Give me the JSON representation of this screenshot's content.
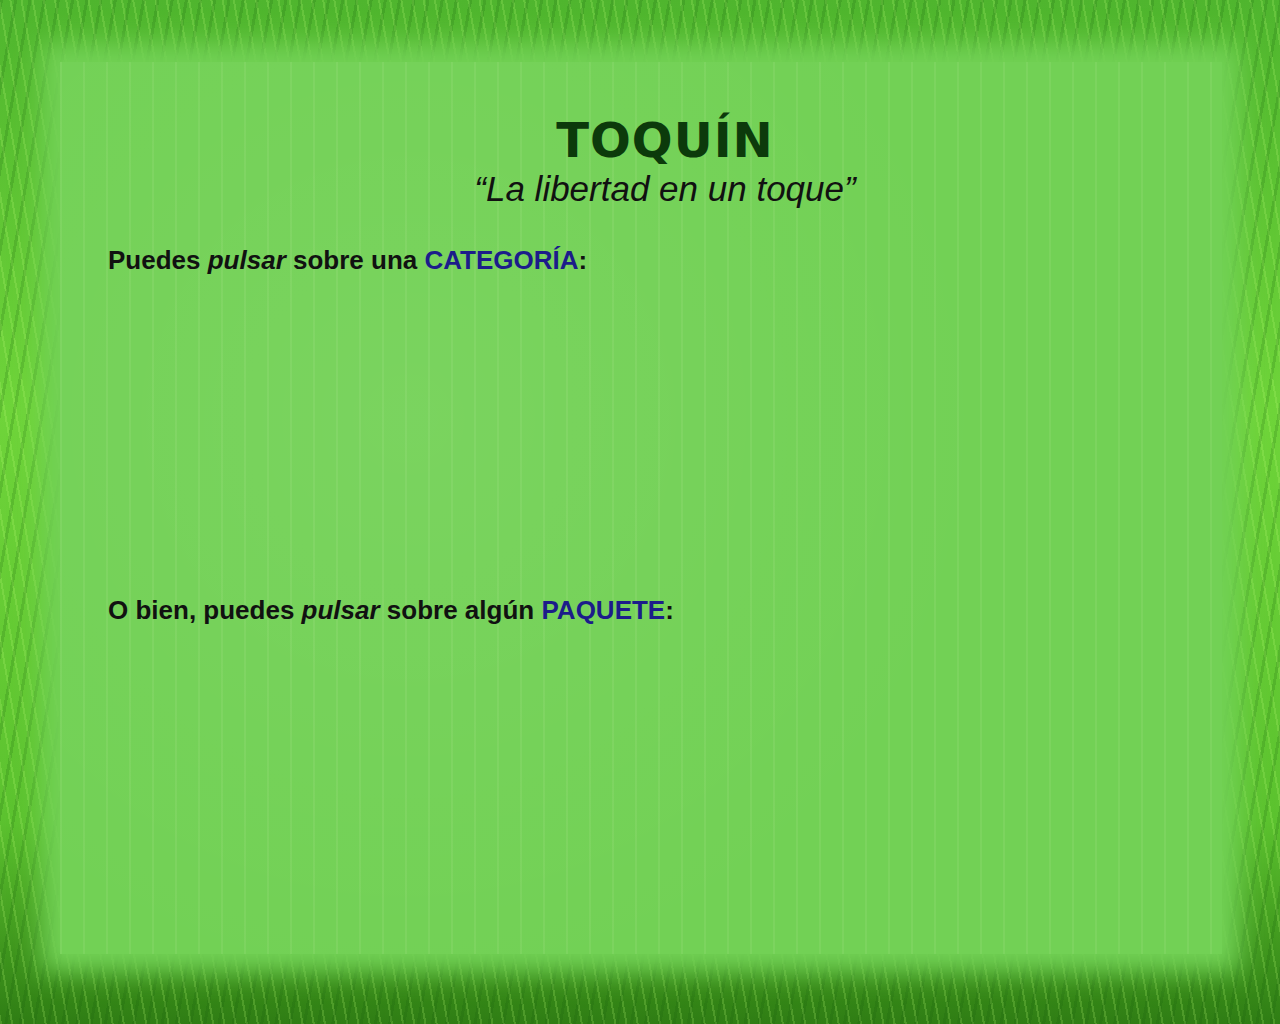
{
  "app": {
    "title": "TOQUÍN",
    "slogan": "“La libertad en un toque”"
  },
  "sections": [
    {
      "name": "categories",
      "prompt": [
        {
          "text": "Puedes ",
          "kind": "plain"
        },
        {
          "text": "pulsar",
          "kind": "emphasis"
        },
        {
          "text": " sobre una ",
          "kind": "plain"
        },
        {
          "text": "CATEGORÍA",
          "kind": "highlight"
        },
        {
          "text": ":",
          "kind": "plain"
        }
      ],
      "items": []
    },
    {
      "name": "packages",
      "prompt": [
        {
          "text": "O bien, puedes ",
          "kind": "plain"
        },
        {
          "text": "pulsar",
          "kind": "emphasis"
        },
        {
          "text": " sobre algún ",
          "kind": "plain"
        },
        {
          "text": "PAQUETE",
          "kind": "highlight"
        },
        {
          "text": ":",
          "kind": "plain"
        }
      ],
      "items": []
    }
  ]
}
